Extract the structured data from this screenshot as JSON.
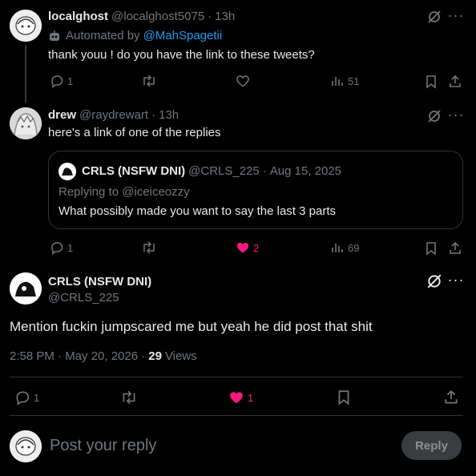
{
  "post1": {
    "name": "localghost",
    "handle": "@localghost5075",
    "sep": "·",
    "time": "13h",
    "automated_prefix": "Automated by",
    "automated_link": "@MahSpagetii",
    "text": "thank youu ! do you have the link to these tweets?",
    "replies": "1",
    "views": "51"
  },
  "post2": {
    "name": "drew",
    "handle": "@raydrewart",
    "sep": "·",
    "time": "13h",
    "text": "here's a link of one of the replies",
    "replies": "1",
    "likes": "2",
    "views": "69",
    "quote": {
      "name": "CRLS (NSFW DNI)",
      "handle": "@CRLS_225",
      "sep": "·",
      "date": "Aug 15, 2025",
      "replying_to": "Replying to @iceiceozzy",
      "text": "What possibly made you want to say the last 3 parts"
    }
  },
  "main": {
    "name": "CRLS (NSFW DNI)",
    "handle": "@CRLS_225",
    "text": "Mention fuckin jumpscared me but yeah he did post that shit",
    "time": "2:58 PM · May 20, 2026 ·",
    "views_count": "29",
    "views_label": "Views",
    "replies": "1",
    "likes": "1"
  },
  "composer": {
    "placeholder": "Post your reply",
    "reply_label": "Reply"
  },
  "colors": {
    "like_active": "#f91880",
    "link": "#1d9bf0",
    "muted": "#71767b"
  }
}
